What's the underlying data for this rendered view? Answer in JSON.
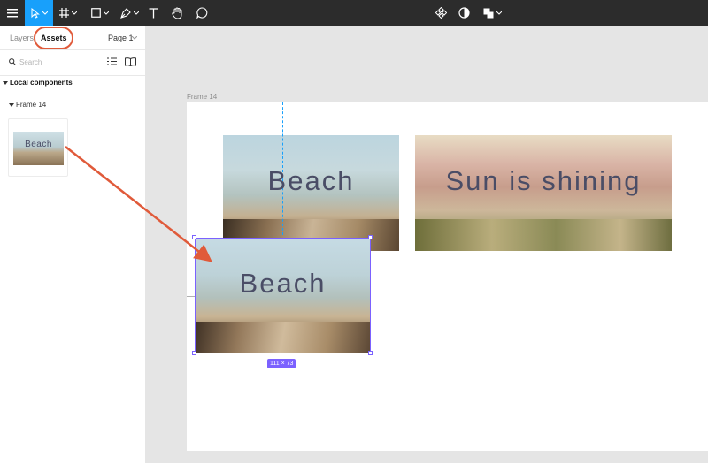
{
  "toolbar": {
    "tools": [
      "main-menu",
      "move",
      "frame",
      "shape",
      "pen",
      "text",
      "hand",
      "comment"
    ],
    "center_tools": [
      "create-component",
      "use-as-mask",
      "boolean-groups"
    ],
    "active_tool": "move",
    "accent": "#18a0fb"
  },
  "sidebar": {
    "tabs": [
      {
        "label": "Layers",
        "active": false
      },
      {
        "label": "Assets",
        "active": true
      }
    ],
    "page_select": "Page 1",
    "search_placeholder": "Search",
    "local_components_label": "Local components",
    "group_label": "Frame 14",
    "component_thumb_text": "Beach"
  },
  "canvas": {
    "frame_name": "Frame 14",
    "images": [
      {
        "text": "Beach"
      },
      {
        "text": "Sun is shining"
      }
    ],
    "dragged_copy_text": "Beach",
    "selection_size": "111 × 73",
    "selection_color": "#7b61ff",
    "annotation_color": "#e05a3a"
  }
}
